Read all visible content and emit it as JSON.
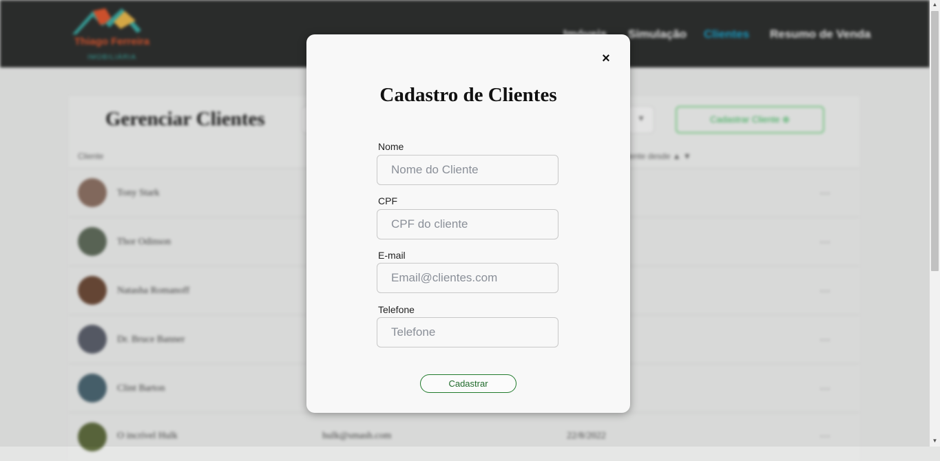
{
  "background": {
    "brand": "Thiago Ferreira",
    "brand_sub": "IMOBILIÁRIA",
    "nav": [
      "Imóveis",
      "Simulação",
      "Clientes",
      "Resumo de Venda"
    ],
    "active_nav": "Clientes",
    "page_title": "Gerenciar Clientes",
    "add_button": "Cadastrar Cliente ⊕",
    "columns": [
      "Cliente",
      "Cliente desde ▲ ▼"
    ],
    "rows": [
      {
        "name": "Tony Stark",
        "email": "",
        "date": "",
        "action": "…"
      },
      {
        "name": "Thor Odinson",
        "email": "",
        "date": "",
        "action": "…"
      },
      {
        "name": "Natasha Romanoff",
        "email": "",
        "date": "",
        "action": "…"
      },
      {
        "name": "Dr. Bruce Banner",
        "email": "",
        "date": "",
        "action": "…"
      },
      {
        "name": "Clint Barton",
        "email": "",
        "date": "",
        "action": "…"
      },
      {
        "name": "O incrível Hulk",
        "email": "hulk@smash.com",
        "date": "22/8/2022",
        "action": "…"
      }
    ]
  },
  "modal": {
    "close_icon": "×",
    "title": "Cadastro de Clientes",
    "fields": {
      "nome": {
        "label": "Nome",
        "placeholder": "Nome do Cliente",
        "value": ""
      },
      "cpf": {
        "label": "CPF",
        "placeholder": "CPF do cliente",
        "value": ""
      },
      "email": {
        "label": "E-mail",
        "placeholder": "Email@clientes.com",
        "value": ""
      },
      "telefone": {
        "label": "Telefone",
        "placeholder": "Telefone",
        "value": ""
      }
    },
    "submit_label": "Cadastrar"
  },
  "colors": {
    "topbar": "#2d2f2e",
    "nav_active": "#1ba0c8",
    "submit_border": "#1f7a2a",
    "add_button_border": "#7dd18a"
  },
  "icons": {
    "close": "close-icon",
    "logo": "house-roof-logo",
    "row_menu": "ellipsis-icon",
    "dropdown": "chevron-down-icon"
  }
}
